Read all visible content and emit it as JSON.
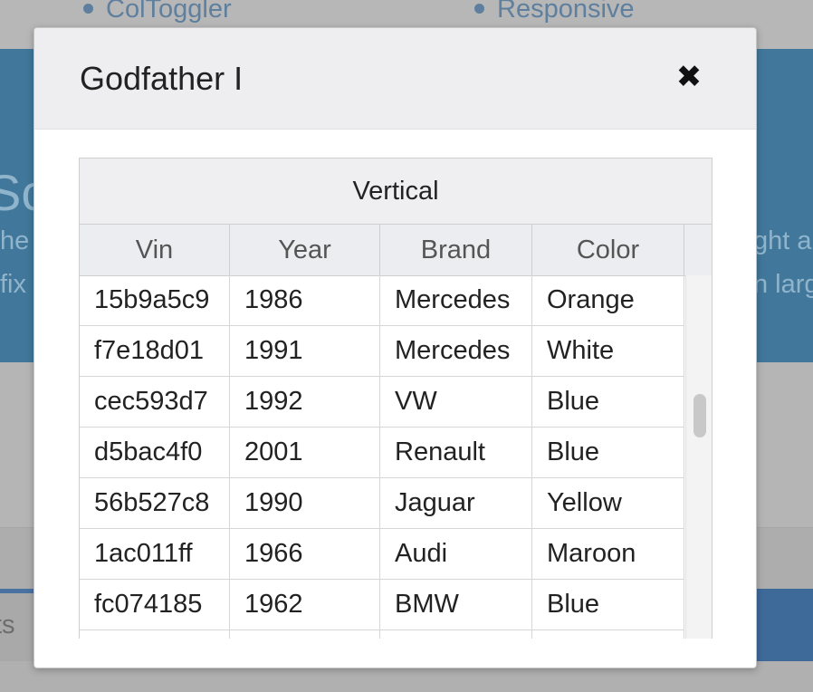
{
  "background": {
    "bullets": [
      "ColToggler",
      "Responsive"
    ],
    "hero_heading_fragment": "Sc",
    "hero_line_left_1": "he",
    "hero_line_left_2": "fix",
    "hero_line_right_1": "ght a",
    "hero_line_right_2": "n larg",
    "footer_fragment": "ts"
  },
  "modal": {
    "title": "Godfather I",
    "close_symbol": "✖"
  },
  "table": {
    "caption": "Vertical",
    "columns": [
      "Vin",
      "Year",
      "Brand",
      "Color"
    ],
    "rows": [
      [
        "15b9a5c9",
        "1986",
        "Mercedes",
        "Orange"
      ],
      [
        "f7e18d01",
        "1991",
        "Mercedes",
        "White"
      ],
      [
        "cec593d7",
        "1992",
        "VW",
        "Blue"
      ],
      [
        "d5bac4f0",
        "2001",
        "Renault",
        "Blue"
      ],
      [
        "56b527c8",
        "1990",
        "Jaguar",
        "Yellow"
      ],
      [
        "1ac011ff",
        "1966",
        "Audi",
        "Maroon"
      ],
      [
        "fc074185",
        "1962",
        "BMW",
        "Blue"
      ],
      [
        "",
        "",
        "",
        ""
      ]
    ]
  },
  "colors": {
    "overlay_blue": "#41779a",
    "modal_header": "#eeeef0",
    "table_header": "#ecedf0"
  }
}
